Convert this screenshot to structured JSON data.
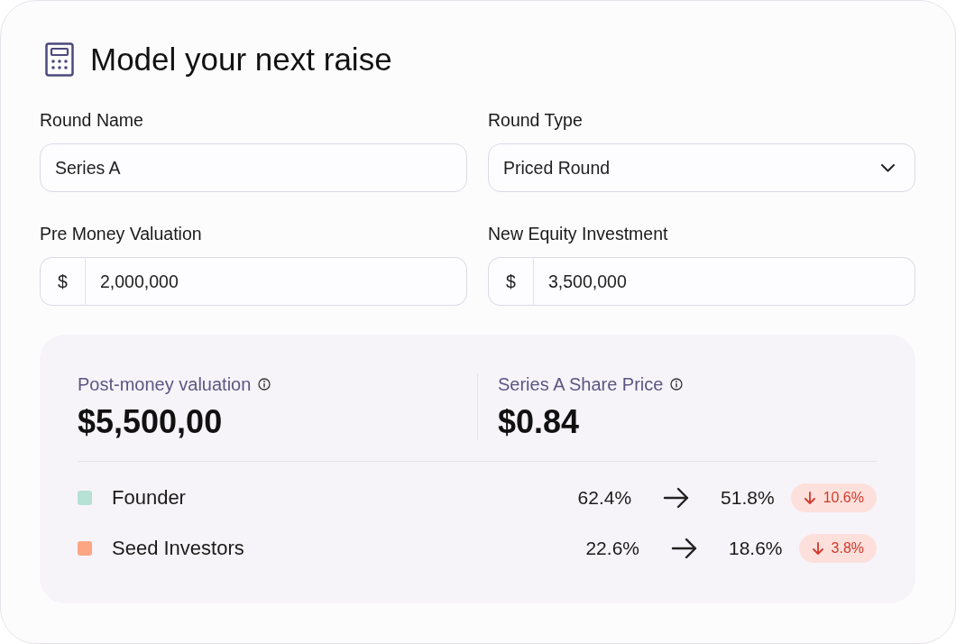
{
  "header": {
    "title": "Model your next raise"
  },
  "fields": [
    {
      "label": "Round Name",
      "kind": "text",
      "value": "Series A"
    },
    {
      "label": "Round Type",
      "kind": "select",
      "value": "Priced Round"
    },
    {
      "label": "Pre Money Valuation",
      "kind": "currency",
      "prefix": "$",
      "value": "2,000,000"
    },
    {
      "label": "New Equity Investment",
      "kind": "currency",
      "prefix": "$",
      "value": "3,500,000"
    }
  ],
  "summary": {
    "metrics": [
      {
        "label": "Post-money valuation",
        "value": "$5,500,00"
      },
      {
        "label": "Series A Share Price",
        "value": "$0.84"
      }
    ],
    "holders": [
      {
        "name": "Founder",
        "color": "#b6e1d4",
        "before": "62.4%",
        "after": "51.8%",
        "change": "10.6%",
        "decrease": true
      },
      {
        "name": "Seed Investors",
        "color": "#fca684",
        "before": "22.6%",
        "after": "18.6%",
        "change": "3.8%",
        "decrease": true
      }
    ]
  }
}
